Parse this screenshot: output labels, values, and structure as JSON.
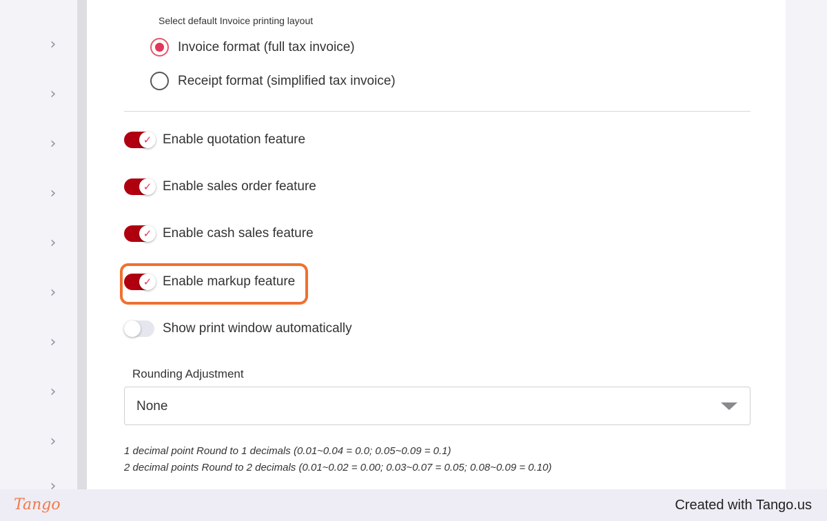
{
  "sidebar": {
    "icon": "chevron-right-icon",
    "chevron_glyph": "›",
    "count": 10
  },
  "layout_section": {
    "label": "Select default Invoice printing layout",
    "options": [
      {
        "label": "Invoice format (full tax invoice)",
        "selected": true
      },
      {
        "label": "Receipt format (simplified tax invoice)",
        "selected": false
      }
    ]
  },
  "features": [
    {
      "label": "Enable quotation feature",
      "enabled": true
    },
    {
      "label": "Enable sales order feature",
      "enabled": true
    },
    {
      "label": "Enable cash sales feature",
      "enabled": true
    },
    {
      "label": "Enable markup feature",
      "enabled": true,
      "highlighted": true
    },
    {
      "label": "Show print window automatically",
      "enabled": false
    }
  ],
  "toggle_check_glyph": "✓",
  "rounding": {
    "label": "Rounding Adjustment",
    "value": "None",
    "notes": [
      "1 decimal point Round to 1 decimals (0.01~0.04 = 0.0; 0.05~0.09 = 0.1)",
      "2 decimal points Round to 2 decimals (0.01~0.02 = 0.00; 0.03~0.07 = 0.05; 0.08~0.09 = 0.10)"
    ]
  },
  "footer": {
    "logo": "Tango",
    "credit": "Created with Tango.us"
  },
  "colors": {
    "toggle_on": "#b00010",
    "radio_on": "#e3365a",
    "highlight": "#f07030",
    "logo": "#f07a4a"
  }
}
